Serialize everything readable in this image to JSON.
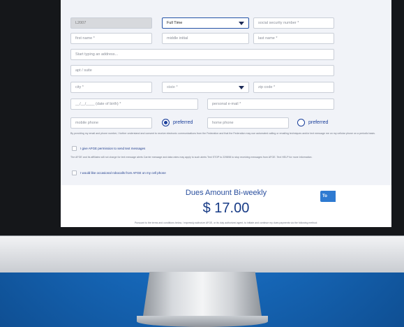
{
  "form": {
    "local_value": "L2007",
    "employment_type": "Full Time",
    "ssn_placeholder": "social security number *",
    "first_name_placeholder": "first name *",
    "middle_initial_placeholder": "middle initial",
    "last_name_placeholder": "last name *",
    "address_placeholder": "Start typing an address...",
    "apt_placeholder": "apt / suite",
    "city_placeholder": "city *",
    "state_placeholder": "state *",
    "zip_placeholder": "zip code *",
    "dob_placeholder": "__/__/____ (date of birth) *",
    "personal_email_placeholder": "personal e-mail *",
    "mobile_phone_placeholder": "mobile phone",
    "home_phone_placeholder": "home phone",
    "preferred_label": "preferred",
    "consent_text": "By providing my email and phone number, I further understand and consent to receive electronic communications from the Federation and that the Federation may use automated calling or emailing techniques and/or text message me on my cellular phone on a periodic basis.",
    "text_permission_label": "I give AFGE permission to send text messages",
    "text_disclaimer": "The AFGE and its affiliates will not charge for text message alerts Carrier message and data rates may apply to such alerts Text STOP to 229898 to stop receiving messages from AFGE. Text HELP for more information.",
    "robocall_label": "I would like occasional robocalls from AFGE on my cell phone"
  },
  "dues": {
    "title": "Dues Amount Bi-weekly",
    "amount": "$ 17.00",
    "note": "Pursuant to the terms and conditions below, I expressly authorize AFGE, or its duly authorized agent, to initiate and continue my dues payments via the following method:"
  },
  "top_button_label": "To"
}
